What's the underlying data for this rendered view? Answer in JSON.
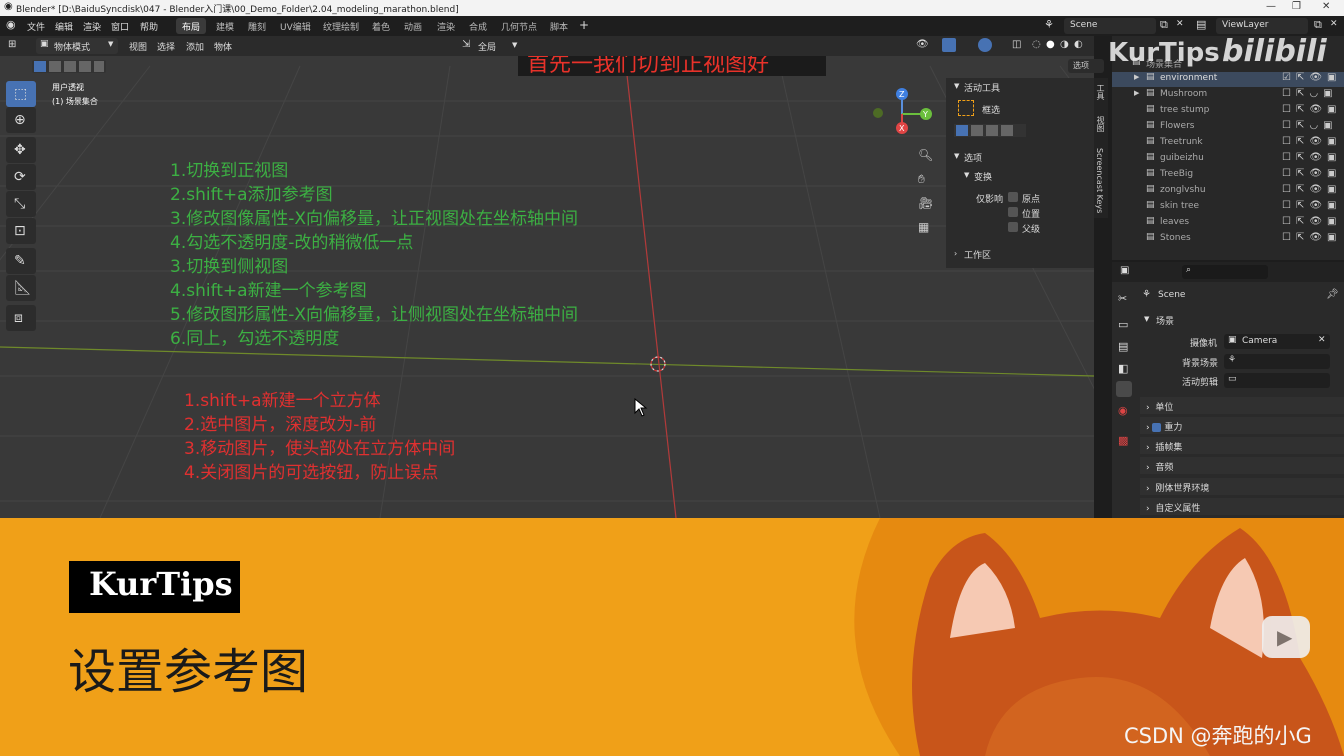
{
  "window": {
    "title": "Blender* [D:\\BaiduSyncdisk\\047 - Blender入门课\\00_Demo_Folder\\2.04_modeling_marathon.blend]"
  },
  "menu": {
    "items": [
      "文件",
      "编辑",
      "渲染",
      "窗口",
      "帮助"
    ]
  },
  "workspaces": [
    "布局",
    "建模",
    "雕刻",
    "UV编辑",
    "纹理绘制",
    "着色",
    "动画",
    "渲染",
    "合成",
    "几何节点",
    "脚本"
  ],
  "scene_field": {
    "value": "Scene"
  },
  "viewlayer_field": {
    "value": "ViewLayer"
  },
  "viewport_header": {
    "mode": "物体模式",
    "menus": [
      "视图",
      "选择",
      "添加",
      "物体"
    ],
    "orientation": "全局",
    "options": "选项"
  },
  "viewport": {
    "view_name": "用户透视",
    "collection": "(1) 场景集合",
    "headline": "首先一我们切到正视图好",
    "steps_green": [
      "1.切换到正视图",
      "2.shift+a添加参考图",
      "3.修改图像属性-X向偏移量，让正视图处在坐标轴中间",
      "4.勾选不透明度-改的稍微低一点",
      "3.切换到侧视图",
      "4.shift+a新建一个参考图",
      "5.修改图形属性-X向偏移量，让侧视图处在坐标轴中间",
      "6.同上，勾选不透明度"
    ],
    "steps_red": [
      "1.shift+a新建一个立方体",
      "2.选中图片，深度改为-前",
      "3.移动图片，使头部处在立方体中间",
      "4.关闭图片的可选按钮，防止误点"
    ]
  },
  "npanel": {
    "active_tool": "活动工具",
    "tool_name": "框选",
    "options": "选项",
    "transform": "变换",
    "affect_only": "仅影响",
    "chk_origin": "原点",
    "chk_location": "位置",
    "chk_parent": "父级",
    "workspace": "工作区",
    "tabs": [
      "工具",
      "视图",
      "Screencast Keys"
    ]
  },
  "outliner": {
    "root": "场景集合",
    "items": [
      "environment",
      "Mushroom",
      "tree stump",
      "Flowers",
      "Treetrunk",
      "guibeizhu",
      "TreeBig",
      "zonglvshu",
      "skin tree",
      "leaves",
      "Stones"
    ]
  },
  "watermark": {
    "kurtips": "KurTips",
    "bili": "bilibili"
  },
  "properties": {
    "scene_name": "Scene",
    "section_scene": "场景",
    "camera_label": "摄像机",
    "camera_value": "Camera",
    "bg_scene_label": "背景场景",
    "clip_label": "活动剪辑",
    "sections": [
      "单位",
      "重力",
      "插帧集",
      "音频",
      "刚体世界环境",
      "自定义属性"
    ]
  },
  "banner": {
    "brand": "KurTips",
    "title": "设置参考图",
    "credit": "CSDN @奔跑的小G"
  },
  "colors": {
    "accent": "#4772b3",
    "banner_bg": "#f0a018",
    "green_text": "#3cb043",
    "red_text": "#e03030"
  }
}
